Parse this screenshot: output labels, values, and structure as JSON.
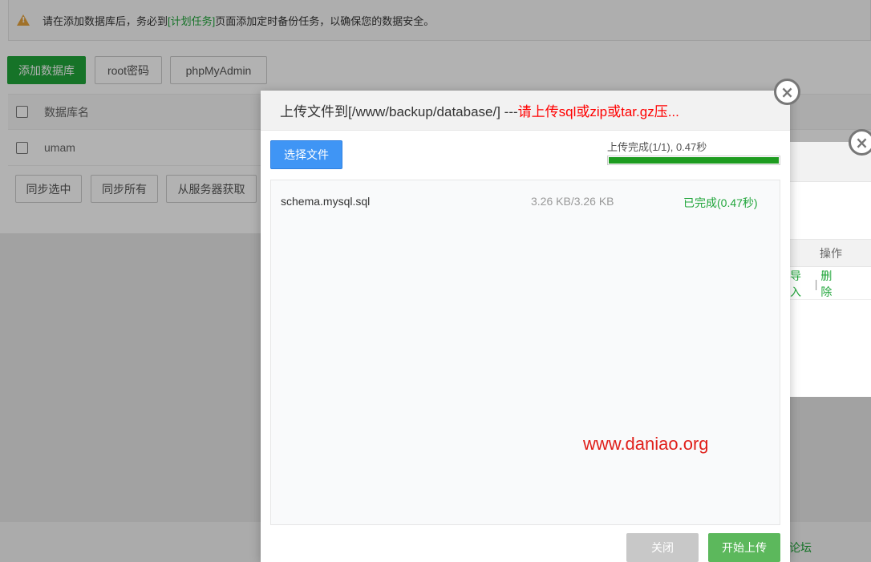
{
  "notice": {
    "prefix": "请在添加数据库后，务必到",
    "link": "[计划任务]",
    "suffix": "页面添加定时备份任务，以确保您的数据安全。"
  },
  "toolbar": {
    "add_db": "添加数据库",
    "root_pwd": "root密码",
    "phpmyadmin": "phpMyAdmin"
  },
  "table": {
    "header": "数据库名",
    "rows": [
      {
        "name": "umam"
      }
    ]
  },
  "sync": {
    "selected": "同步选中",
    "all": "同步所有",
    "from_server": "从服务器获取"
  },
  "back_dialog": {
    "ops_header": "操作",
    "action_import": "导入",
    "separator": "|",
    "action_delete": "删除"
  },
  "footer": {
    "forum": "论坛"
  },
  "upload_dialog": {
    "title_prefix": "上传文件到[/www/backup/database/] --- ",
    "title_hint": "请上传sql或zip或tar.gz压...",
    "choose_btn": "选择文件",
    "progress_text": "上传完成(1/1), 0.47秒",
    "progress_value": 1.0,
    "files": [
      {
        "name": "schema.mysql.sql",
        "size": "3.26 KB/3.26 KB",
        "status": "已完成(0.47秒)"
      }
    ],
    "watermark": "www.daniao.org",
    "close_btn": "关闭",
    "start_btn": "开始上传"
  },
  "colors": {
    "accent_green": "#20a53a",
    "progress_green": "#1e9c20",
    "primary_blue": "#3f95f5",
    "warning": "#e6a23c",
    "hint_red": "#ff0000"
  }
}
